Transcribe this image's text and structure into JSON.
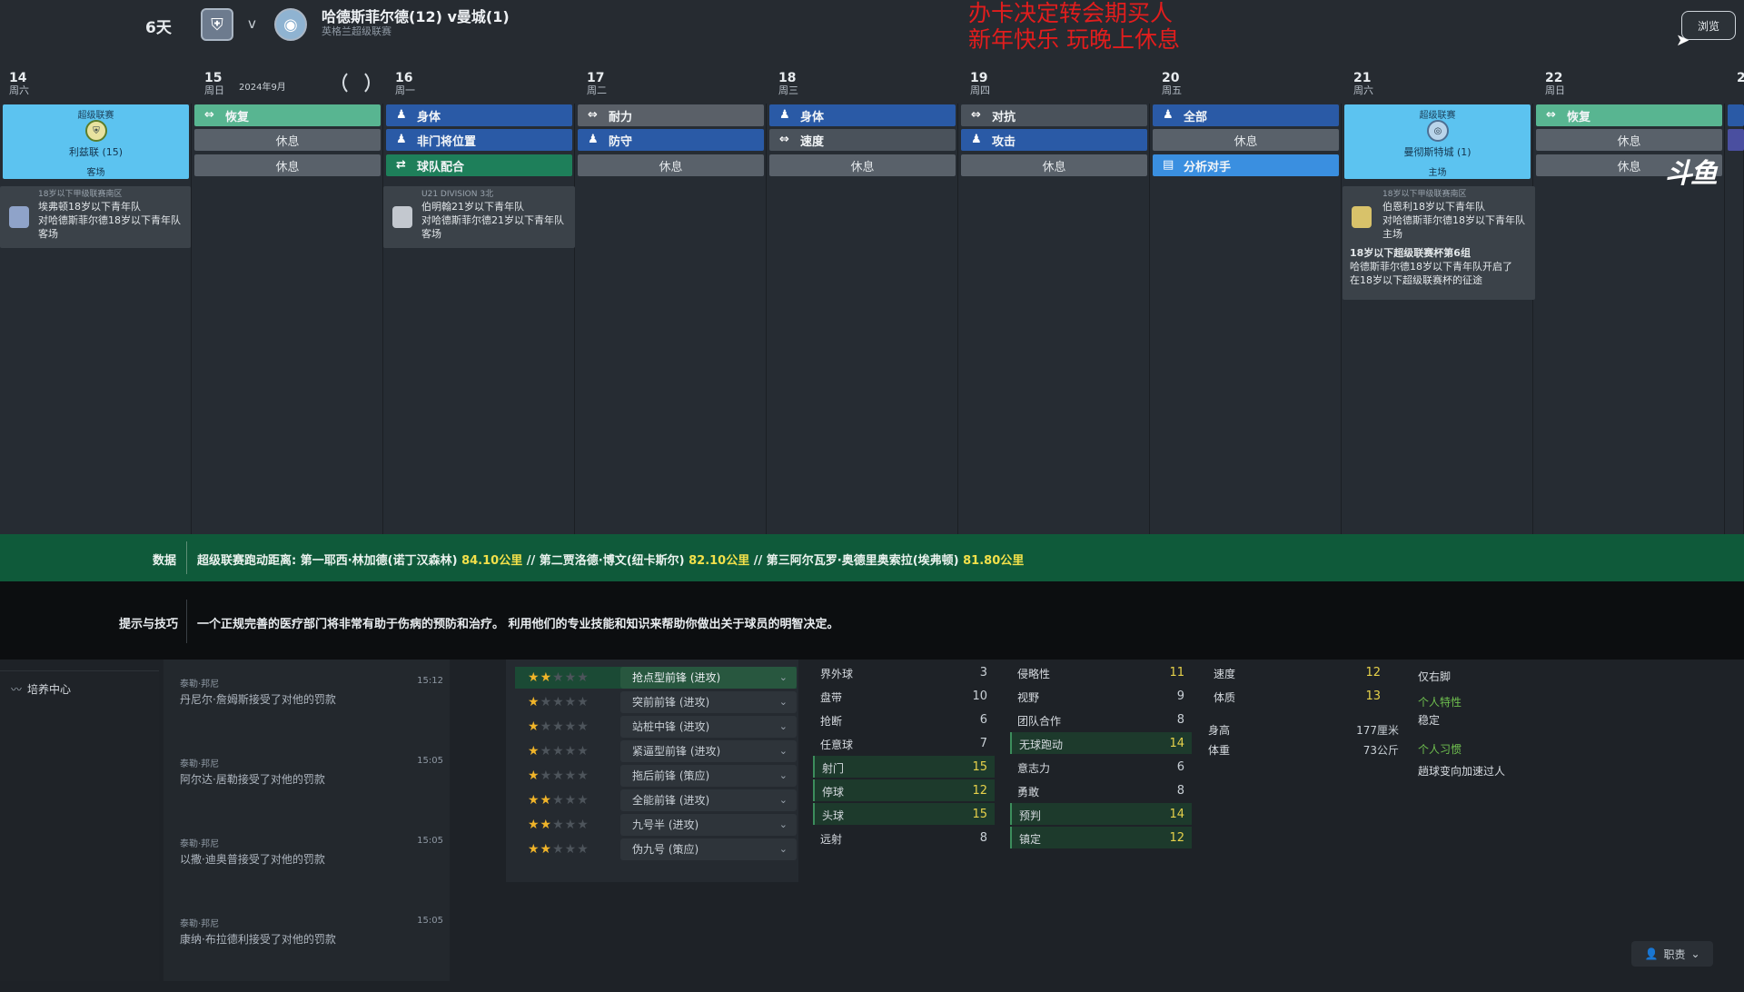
{
  "header": {
    "countdown": "6天",
    "vs": "v",
    "match_title": "哈德斯菲尔德(12) v曼城(1)",
    "competition": "英格兰超级联赛",
    "overlay_line1": "办卡决定转会期买人",
    "overlay_line2": "新年快乐 玩晚上休息",
    "browse_label": "浏览"
  },
  "calendar": {
    "month_label": "2024年9月",
    "days": [
      {
        "num": "14",
        "wd": "周六"
      },
      {
        "num": "15",
        "wd": "周日"
      },
      {
        "num": "16",
        "wd": "周一"
      },
      {
        "num": "17",
        "wd": "周二"
      },
      {
        "num": "18",
        "wd": "周三"
      },
      {
        "num": "19",
        "wd": "周四"
      },
      {
        "num": "20",
        "wd": "周五"
      },
      {
        "num": "21",
        "wd": "周六"
      },
      {
        "num": "22",
        "wd": "周日"
      },
      {
        "num": "2",
        "wd": ""
      }
    ],
    "match14": {
      "comp": "超级联赛",
      "opp": "利兹联 (15)",
      "venue": "客场"
    },
    "match21": {
      "comp": "超级联赛",
      "opp": "曼彻斯特城 (1)",
      "venue": "主场"
    },
    "sessions": {
      "d15": [
        "恢复",
        "休息",
        "休息"
      ],
      "d16": [
        "身体",
        "非门将位置",
        "球队配合"
      ],
      "d17": [
        "耐力",
        "防守",
        "休息"
      ],
      "d18": [
        "身体",
        "速度",
        "休息"
      ],
      "d19": [
        "对抗",
        "攻击",
        "休息"
      ],
      "d20": [
        "全部",
        "休息",
        "分析对手"
      ],
      "d22": [
        "恢复",
        "休息",
        "休息"
      ]
    },
    "youth14": {
      "comp": "18岁以下甲级联赛南区",
      "line1": "埃弗顿18岁以下青年队",
      "line2": "对哈德斯菲尔德18岁以下青年队",
      "line3": "客场"
    },
    "youth16": {
      "comp": "U21 DIVISION 3北",
      "line1": "伯明翰21岁以下青年队",
      "line2": "对哈德斯菲尔德21岁以下青年队",
      "line3": "客场"
    },
    "youth21": {
      "comp": "18岁以下甲级联赛南区",
      "line1": "伯恩利18岁以下青年队",
      "line2": "对哈德斯菲尔德18岁以下青年队",
      "line3": "主场",
      "cup_title": "18岁以下超级联赛杯第6组",
      "cup_text1": "哈德斯菲尔德18岁以下青年队开启了",
      "cup_text2": "在18岁以下超级联赛杯的征途"
    },
    "watermark": "斗鱼"
  },
  "data_bar": {
    "label": "数据",
    "prefix": "超级联赛跑动距离: 第一耶西·林加德(诺丁汉森林) ",
    "v1": "84.10公里",
    "mid1": " // 第二贾洛德·博文(纽卡斯尔) ",
    "v2": "82.10公里",
    "mid2": " // 第三阿尔瓦罗·奥德里奥索拉(埃弗顿) ",
    "v3": "81.80公里"
  },
  "tips": {
    "label": "提示与技巧",
    "text": "一个正规完善的医疗部门将非常有助于伤病的预防和治疗。 利用他们的专业技能和知识来帮助你做出关于球员的明智决定。"
  },
  "nav": {
    "item": "培养中心"
  },
  "news": [
    {
      "src": "泰勒·邦尼",
      "time": "15:12",
      "text": "丹尼尔·詹姆斯接受了对他的罚款"
    },
    {
      "src": "泰勒·邦尼",
      "time": "15:05",
      "text": "阿尔达·居勒接受了对他的罚款"
    },
    {
      "src": "泰勒·邦尼",
      "time": "15:05",
      "text": "以撒·迪奥普接受了对他的罚款"
    },
    {
      "src": "泰勒·邦尼",
      "time": "15:05",
      "text": "康纳·布拉德利接受了对他的罚款"
    }
  ],
  "roles": [
    {
      "label": "抢点型前锋 (进攻)",
      "stars": 1.5
    },
    {
      "label": "突前前锋 (进攻)",
      "stars": 1
    },
    {
      "label": "站桩中锋 (进攻)",
      "stars": 1
    },
    {
      "label": "紧逼型前锋 (进攻)",
      "stars": 1
    },
    {
      "label": "拖后前锋 (策应)",
      "stars": 1
    },
    {
      "label": "全能前锋 (进攻)",
      "stars": 2
    },
    {
      "label": "九号半 (进攻)",
      "stars": 2
    },
    {
      "label": "伪九号 (策应)",
      "stars": 1.5
    }
  ],
  "attributes": {
    "technical": [
      {
        "name": "界外球",
        "value": "3"
      },
      {
        "name": "盘带",
        "value": "10"
      },
      {
        "name": "抢断",
        "value": "6"
      },
      {
        "name": "任意球",
        "value": "7"
      },
      {
        "name": "射门",
        "value": "15"
      },
      {
        "name": "停球",
        "value": "12"
      },
      {
        "name": "头球",
        "value": "15"
      },
      {
        "name": "远射",
        "value": "8"
      }
    ],
    "mental": [
      {
        "name": "侵略性",
        "value": "11"
      },
      {
        "name": "视野",
        "value": "9"
      },
      {
        "name": "团队合作",
        "value": "8"
      },
      {
        "name": "无球跑动",
        "value": "14"
      },
      {
        "name": "意志力",
        "value": "6"
      },
      {
        "name": "勇敢",
        "value": "8"
      },
      {
        "name": "预判",
        "value": "14"
      },
      {
        "name": "镇定",
        "value": "12"
      }
    ],
    "physical": [
      {
        "name": "速度",
        "value": "12"
      },
      {
        "name": "体质",
        "value": "13"
      }
    ],
    "height_label": "身高",
    "height": "177厘米",
    "weight_label": "体重",
    "weight": "73公斤"
  },
  "traits": {
    "foot": "仅右脚",
    "personal_h": "个人特性",
    "personal": "稳定",
    "habit_h": "个人习惯",
    "habit": "趟球变向加速过人"
  },
  "duty_label": "职责"
}
